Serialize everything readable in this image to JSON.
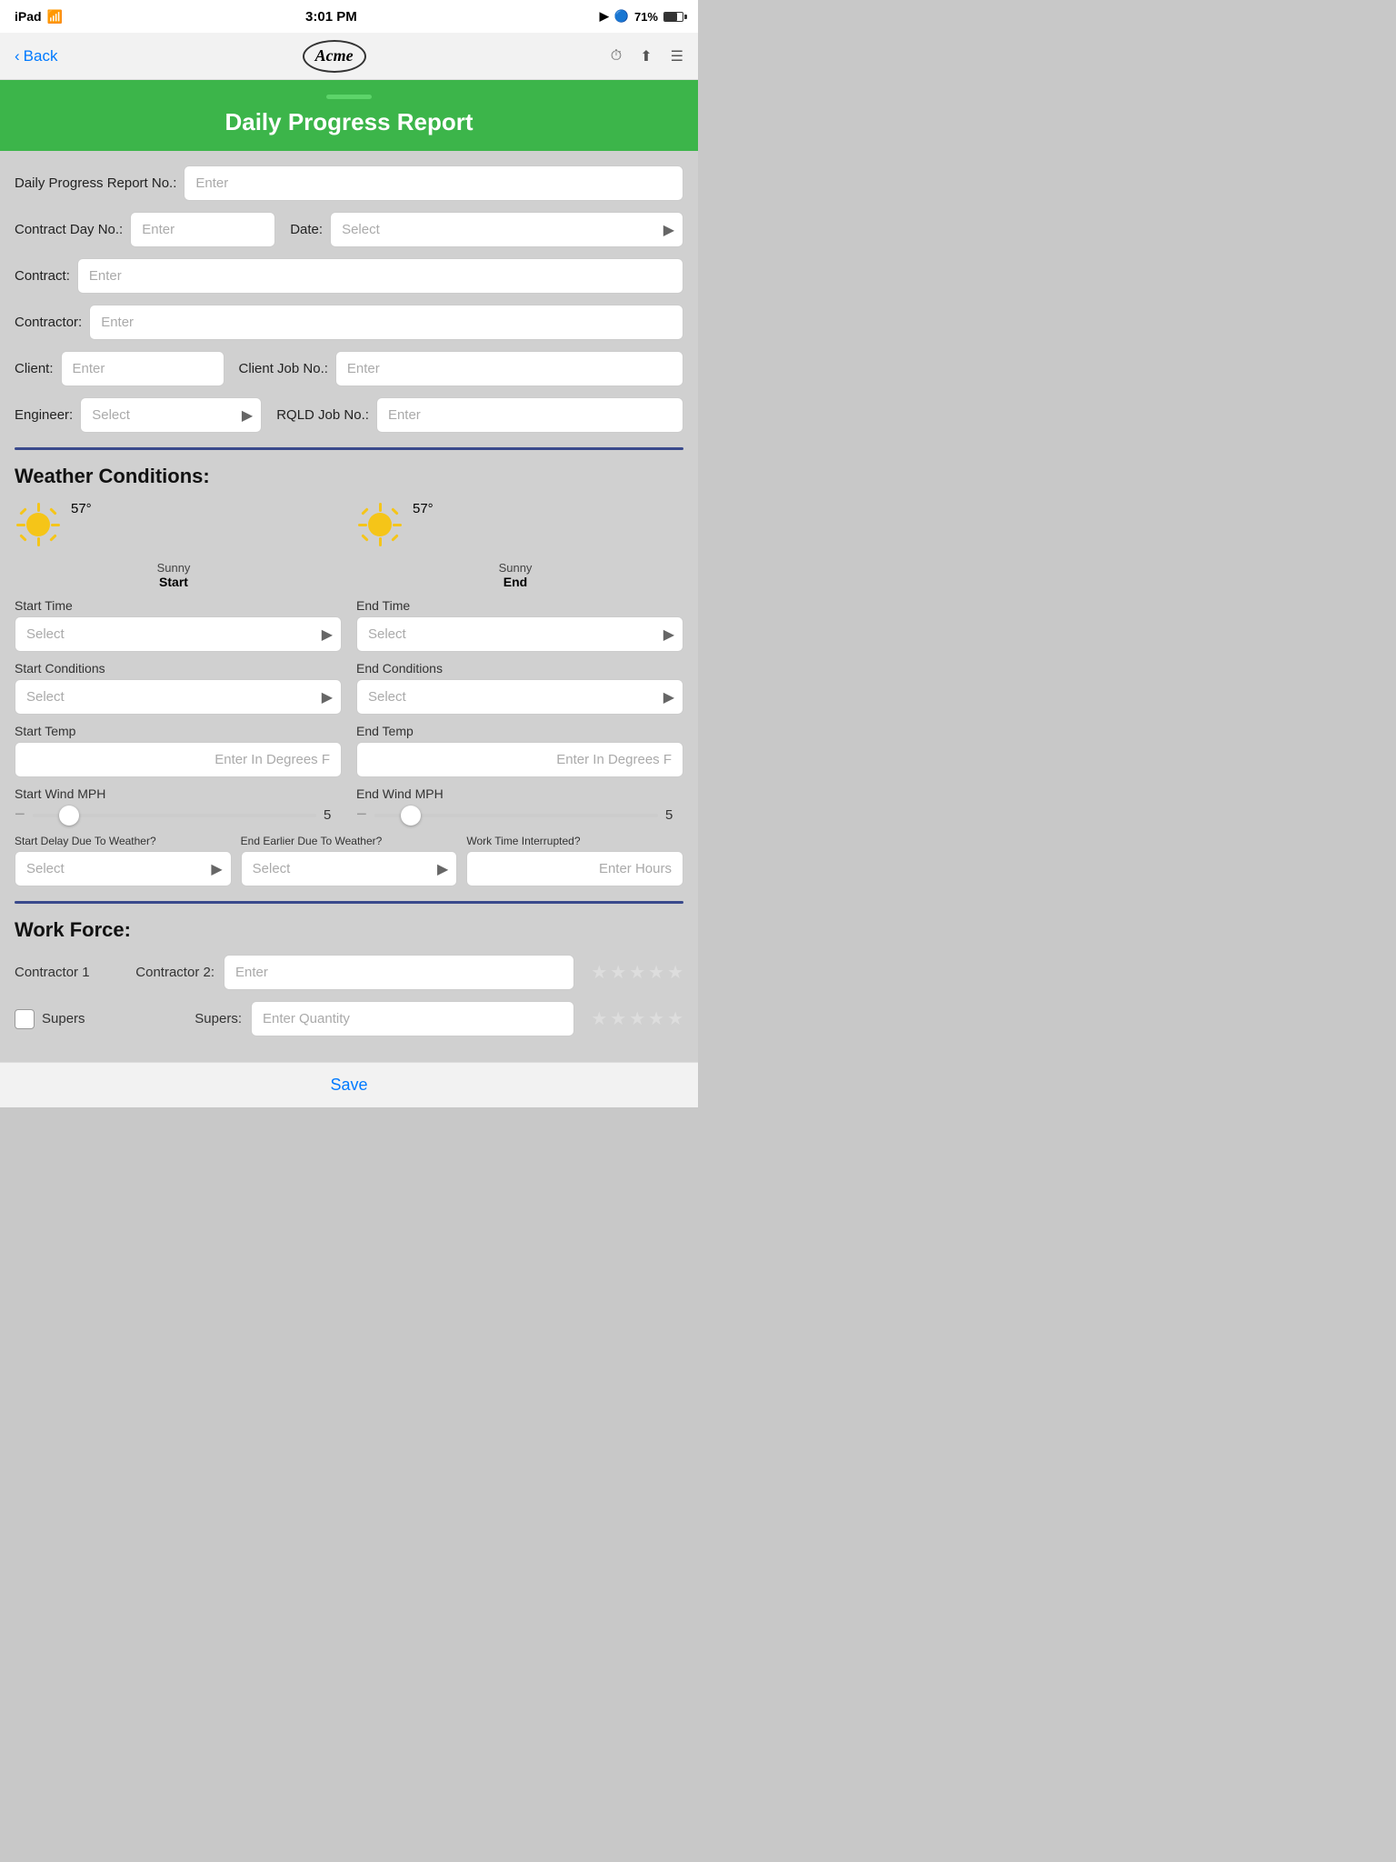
{
  "statusBar": {
    "carrier": "iPad",
    "wifi": "wifi",
    "time": "3:01 PM",
    "locationArrow": "▶",
    "bluetooth": "bluetooth",
    "battery": "71%"
  },
  "navBar": {
    "backLabel": "Back",
    "logoText": "Acme",
    "historyIcon": "⏱",
    "shareIcon": "⬆",
    "menuIcon": "☰"
  },
  "header": {
    "title": "Daily Progress Report"
  },
  "form": {
    "reportNoLabel": "Daily Progress Report No.:",
    "reportNoPlaceholder": "Enter",
    "contractDayLabel": "Contract Day No.:",
    "contractDayPlaceholder": "Enter",
    "dateLabel": "Date:",
    "datePlaceholder": "Select",
    "contractLabel": "Contract:",
    "contractPlaceholder": "Enter",
    "contractorLabel": "Contractor:",
    "contractorPlaceholder": "Enter",
    "clientLabel": "Client:",
    "clientPlaceholder": "Enter",
    "clientJobNoLabel": "Client Job No.:",
    "clientJobNoPlaceholder": "Enter",
    "engineerLabel": "Engineer:",
    "engineerPlaceholder": "Select",
    "rqldJobNoLabel": "RQLD Job No.:",
    "rqldJobNoPlaceholder": "Enter"
  },
  "weather": {
    "sectionTitle": "Weather Conditions:",
    "start": {
      "temp": "57°",
      "condition": "Sunny",
      "label": "Start",
      "timeLabel": "Start Time",
      "timePlaceholder": "Select",
      "conditionsLabel": "Start Conditions",
      "conditionsPlaceholder": "Select",
      "tempLabel": "Start Temp",
      "tempPlaceholder": "Enter In Degrees F",
      "windLabel": "Start Wind MPH",
      "windValue": 5,
      "windMin": 0,
      "windMax": 50
    },
    "end": {
      "temp": "57°",
      "condition": "Sunny",
      "label": "End",
      "timeLabel": "End Time",
      "timePlaceholder": "Select",
      "conditionsLabel": "End Conditions",
      "conditionsPlaceholder": "Select",
      "tempLabel": "End Temp",
      "tempPlaceholder": "Enter In Degrees F",
      "windLabel": "End Wind MPH",
      "windValue": 5,
      "windMin": 0,
      "windMax": 50
    },
    "delayLabel": "Start Delay Due To Weather?",
    "delayPlaceholder": "Select",
    "endEarlyLabel": "End Earlier Due To Weather?",
    "endEarlyPlaceholder": "Select",
    "interruptedLabel": "Work Time Interrupted?",
    "interruptedPlaceholder": "Enter Hours"
  },
  "workforce": {
    "sectionTitle": "Work Force:",
    "contractor1Label": "Contractor 1",
    "contractor2Label": "Contractor 2:",
    "contractor2Placeholder": "Enter",
    "supersLabel": "Supers",
    "superstLabel2": "Supers:",
    "supersPlaceholder": "Enter Quantity"
  },
  "footer": {
    "saveLabel": "Save"
  }
}
